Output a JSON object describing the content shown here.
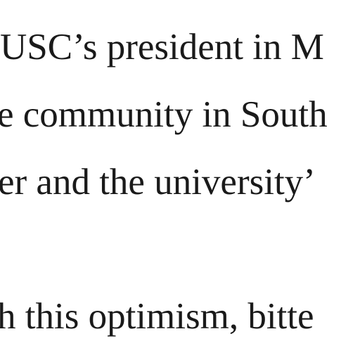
{
  "article": {
    "lines": [
      "USC’s president in M",
      "e community in South",
      "er and the university’",
      "h this optimism, bitte"
    ]
  }
}
